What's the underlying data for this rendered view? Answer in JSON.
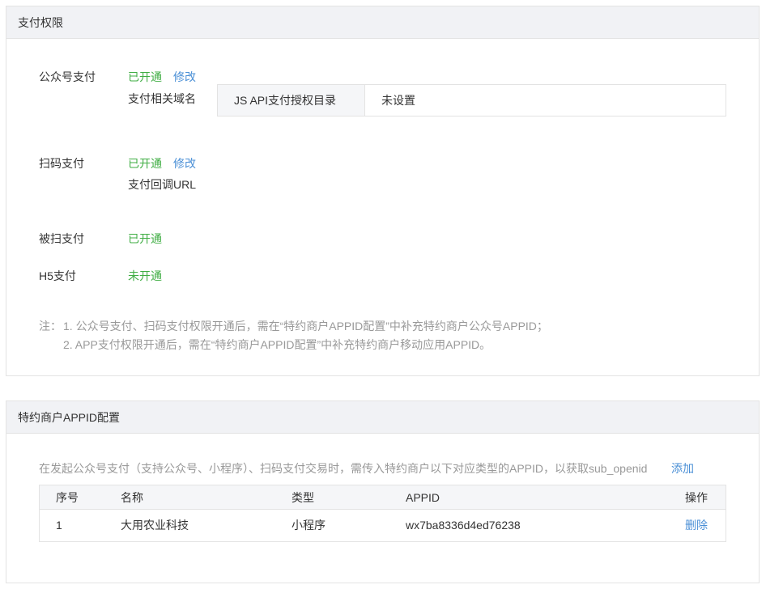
{
  "permissions_panel": {
    "title": "支付权限",
    "official_account_pay": {
      "label": "公众号支付",
      "status": "已开通",
      "edit": "修改",
      "sub_label": "支付相关域名",
      "jsapi_key": "JS API支付授权目录",
      "jsapi_value": "未设置"
    },
    "scan_pay": {
      "label": "扫码支付",
      "status": "已开通",
      "edit": "修改",
      "sub_label": "支付回调URL"
    },
    "scanned_pay": {
      "label": "被扫支付",
      "status": "已开通"
    },
    "h5_pay": {
      "label": "H5支付",
      "status": "未开通"
    },
    "notes": {
      "prefix": "注：",
      "line1": "1. 公众号支付、扫码支付权限开通后，需在“特约商户APPID配置”中补充特约商户公众号APPID；",
      "line2": "2. APP支付权限开通后，需在“特约商户APPID配置”中补充特约商户移动应用APPID。"
    }
  },
  "appid_panel": {
    "title": "特约商户APPID配置",
    "description": "在发起公众号支付（支持公众号、小程序）、扫码支付交易时，需传入特约商户以下对应类型的APPID，以获取sub_openid",
    "add_label": "添加",
    "table": {
      "headers": [
        "序号",
        "名称",
        "类型",
        "APPID",
        "操作"
      ],
      "rows": [
        {
          "index": "1",
          "name": "大用农业科技",
          "type": "小程序",
          "appid": "wx7ba8336d4ed76238",
          "action": "删除"
        }
      ]
    }
  },
  "colors": {
    "enabled_green": "#3fad43",
    "link_blue": "#4a8fd6",
    "note_gray": "#999999"
  }
}
